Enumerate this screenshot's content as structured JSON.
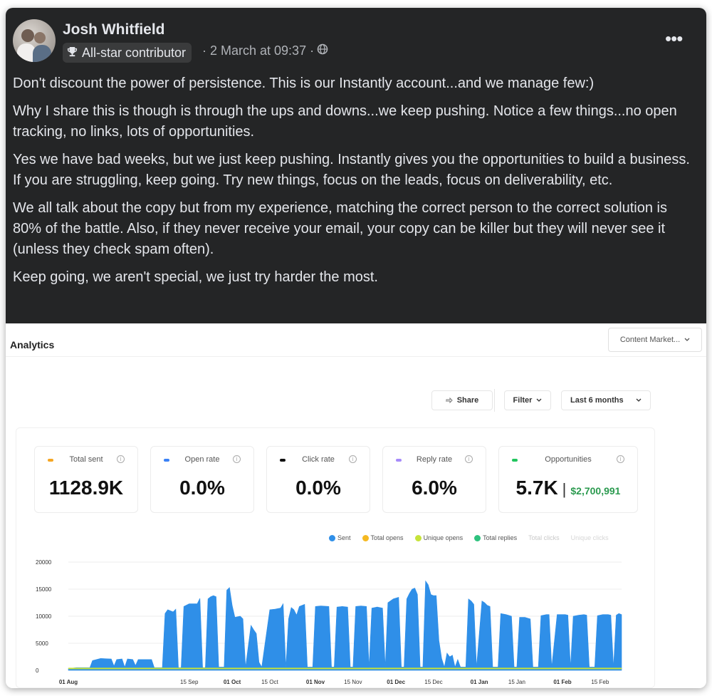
{
  "post": {
    "author": "Josh Whitfield",
    "badge": "All-star contributor",
    "timestamp": "· 2 March at 09:37 ·",
    "more_label": "•••",
    "paragraphs": [
      "Don't discount the power of persistence. This is our Instantly account...and we manage few:)",
      "Why I share this is though is through the ups and downs...we keep pushing. Notice a few things...no open tracking, no links, lots of opportunities.",
      "Yes we have bad weeks, but we just keep pushing. Instantly gives you the opportunities to build a business. If you are struggling, keep going. Try new things, focus on the leads, focus on deliverability, etc.",
      "We all talk about the copy but from my experience, matching the correct person to the correct solution is 80% of the battle. Also, if they never receive your email, your copy can be killer but they will never see it (unless they check spam often).",
      "Keep going, we aren't special, we just try harder the most."
    ],
    "icons": {
      "badge": "trophy-icon",
      "privacy": "globe-icon",
      "more": "more-options-icon"
    }
  },
  "analytics": {
    "title": "Analytics",
    "workspace": "Content Market...",
    "share_label": "Share",
    "filter_label": "Filter",
    "range_label": "Last 6 months",
    "stats": [
      {
        "label": "Total sent",
        "value": "1128.9K",
        "color": "#f5a623"
      },
      {
        "label": "Open rate",
        "value": "0.0%",
        "color": "#3b82f6"
      },
      {
        "label": "Click rate",
        "value": "0.0%",
        "color": "#111111"
      },
      {
        "label": "Reply rate",
        "value": "6.0%",
        "color": "#a78bfa"
      },
      {
        "label": "Opportunities",
        "value": "5.7K",
        "money": "$2,700,991",
        "color": "#22c55e"
      }
    ],
    "legend": [
      {
        "name": "Sent",
        "color": "#2f8fe8"
      },
      {
        "name": "Total opens",
        "color": "#f5b921"
      },
      {
        "name": "Unique opens",
        "color": "#c6e33a"
      },
      {
        "name": "Total replies",
        "color": "#2ec27e"
      },
      {
        "name": "Total clicks",
        "color": "#d8d8d8"
      },
      {
        "name": "Unique clicks",
        "color": "#eeeeee"
      }
    ]
  },
  "chart_data": {
    "type": "area",
    "ylim": [
      0,
      20000
    ],
    "yticks": [
      "20000",
      "15000",
      "10000",
      "5000",
      "0"
    ],
    "xticks": [
      {
        "label": "01 Aug",
        "bold": true,
        "day": 0
      },
      {
        "label": "15 Sep",
        "bold": false,
        "day": 45
      },
      {
        "label": "01 Oct",
        "bold": true,
        "day": 61
      },
      {
        "label": "15 Oct",
        "bold": false,
        "day": 75
      },
      {
        "label": "01 Nov",
        "bold": true,
        "day": 92
      },
      {
        "label": "15 Nov",
        "bold": false,
        "day": 106
      },
      {
        "label": "01 Dec",
        "bold": true,
        "day": 122
      },
      {
        "label": "15 Dec",
        "bold": false,
        "day": 136
      },
      {
        "label": "01 Jan",
        "bold": true,
        "day": 153
      },
      {
        "label": "15 Jan",
        "bold": false,
        "day": 167
      },
      {
        "label": "01 Feb",
        "bold": true,
        "day": 184
      },
      {
        "label": "15 Feb",
        "bold": false,
        "day": 198
      }
    ],
    "series": [
      {
        "name": "Sent",
        "color": "#2f8fe8",
        "points": [
          [
            0,
            300
          ],
          [
            3,
            500
          ],
          [
            8,
            500
          ],
          [
            9,
            1800
          ],
          [
            12,
            2200
          ],
          [
            16,
            2100
          ],
          [
            17,
            800
          ],
          [
            18,
            2000
          ],
          [
            20,
            2100
          ],
          [
            21,
            600
          ],
          [
            22,
            2100
          ],
          [
            24,
            2000
          ],
          [
            25,
            900
          ],
          [
            26,
            2000
          ],
          [
            31,
            2000
          ],
          [
            32,
            500
          ],
          [
            35,
            500
          ],
          [
            36,
            10500
          ],
          [
            37,
            11200
          ],
          [
            39,
            10800
          ],
          [
            40,
            11300
          ],
          [
            41,
            500
          ],
          [
            42,
            500
          ],
          [
            43,
            11800
          ],
          [
            45,
            12300
          ],
          [
            48,
            12300
          ],
          [
            49,
            13300
          ],
          [
            50,
            500
          ],
          [
            51,
            500
          ],
          [
            52,
            13200
          ],
          [
            53,
            13600
          ],
          [
            54,
            13800
          ],
          [
            55,
            13600
          ],
          [
            56,
            600
          ],
          [
            58,
            600
          ],
          [
            59,
            14800
          ],
          [
            60,
            15300
          ],
          [
            61,
            12000
          ],
          [
            62,
            9800
          ],
          [
            64,
            10000
          ],
          [
            65,
            9500
          ],
          [
            66,
            600
          ],
          [
            67,
            4500
          ],
          [
            68,
            8300
          ],
          [
            69,
            7500
          ],
          [
            70,
            6800
          ],
          [
            71,
            1500
          ],
          [
            72,
            600
          ],
          [
            75,
            11200
          ],
          [
            77,
            11300
          ],
          [
            79,
            11500
          ],
          [
            80,
            12300
          ],
          [
            81,
            600
          ],
          [
            82,
            9500
          ],
          [
            83,
            11600
          ],
          [
            84,
            11200
          ],
          [
            85,
            10200
          ],
          [
            86,
            11800
          ],
          [
            87,
            12000
          ],
          [
            88,
            12200
          ],
          [
            89,
            600
          ],
          [
            91,
            600
          ],
          [
            92,
            11800
          ],
          [
            94,
            11900
          ],
          [
            97,
            11800
          ],
          [
            98,
            600
          ],
          [
            99,
            600
          ],
          [
            100,
            11700
          ],
          [
            102,
            11800
          ],
          [
            104,
            11700
          ],
          [
            105,
            600
          ],
          [
            106,
            600
          ],
          [
            107,
            11800
          ],
          [
            109,
            11900
          ],
          [
            111,
            11800
          ],
          [
            112,
            600
          ],
          [
            113,
            11500
          ],
          [
            115,
            11700
          ],
          [
            117,
            11500
          ],
          [
            118,
            600
          ],
          [
            119,
            12500
          ],
          [
            121,
            13200
          ],
          [
            123,
            13500
          ],
          [
            124,
            600
          ],
          [
            125,
            600
          ],
          [
            126,
            13200
          ],
          [
            127,
            14200
          ],
          [
            128,
            15000
          ],
          [
            129,
            15200
          ],
          [
            130,
            14000
          ],
          [
            131,
            600
          ],
          [
            132,
            600
          ],
          [
            133,
            16500
          ],
          [
            134,
            15800
          ],
          [
            135,
            14000
          ],
          [
            136,
            13800
          ],
          [
            137,
            13800
          ],
          [
            138,
            5500
          ],
          [
            139,
            2200
          ],
          [
            140,
            600
          ],
          [
            141,
            3200
          ],
          [
            142,
            2500
          ],
          [
            143,
            2800
          ],
          [
            144,
            600
          ],
          [
            145,
            2000
          ],
          [
            146,
            600
          ],
          [
            148,
            600
          ],
          [
            149,
            13200
          ],
          [
            150,
            12800
          ],
          [
            151,
            12200
          ],
          [
            152,
            600
          ],
          [
            154,
            12800
          ],
          [
            155,
            12500
          ],
          [
            156,
            12000
          ],
          [
            157,
            11800
          ],
          [
            158,
            600
          ],
          [
            160,
            600
          ],
          [
            161,
            10500
          ],
          [
            163,
            10300
          ],
          [
            165,
            10000
          ],
          [
            166,
            600
          ],
          [
            167,
            600
          ],
          [
            168,
            9800
          ],
          [
            170,
            9800
          ],
          [
            172,
            9500
          ],
          [
            173,
            600
          ],
          [
            175,
            600
          ],
          [
            176,
            10100
          ],
          [
            178,
            10300
          ],
          [
            179,
            10300
          ],
          [
            180,
            600
          ],
          [
            182,
            10300
          ],
          [
            183,
            10300
          ],
          [
            185,
            10300
          ],
          [
            186,
            10200
          ],
          [
            187,
            600
          ],
          [
            188,
            10000
          ],
          [
            190,
            10200
          ],
          [
            192,
            10300
          ],
          [
            193,
            10200
          ],
          [
            194,
            600
          ],
          [
            196,
            600
          ],
          [
            197,
            10100
          ],
          [
            199,
            10300
          ],
          [
            201,
            10300
          ],
          [
            202,
            10200
          ],
          [
            203,
            600
          ],
          [
            204,
            10200
          ],
          [
            205,
            10500
          ],
          [
            206,
            10300
          ]
        ]
      },
      {
        "name": "Total replies",
        "color": "#c6e33a",
        "points": [
          [
            0,
            350
          ],
          [
            206,
            350
          ]
        ]
      }
    ]
  }
}
